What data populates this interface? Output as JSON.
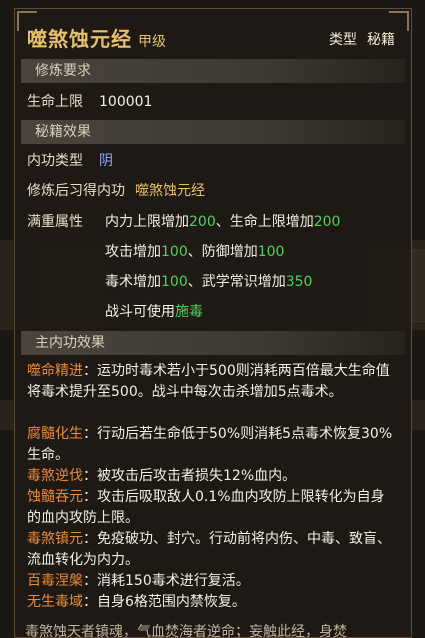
{
  "header": {
    "title": "噬煞蚀元经",
    "grade": "甲级",
    "type_label": "类型",
    "type_value": "秘籍"
  },
  "sections": {
    "requirement": "修炼要求",
    "effect": "秘籍效果",
    "main": "主内功效果"
  },
  "requirement": {
    "label": "生命上限",
    "value": "100001"
  },
  "effect": {
    "type_label": "内功类型",
    "type_value": "阴",
    "learn_label": "修炼后习得内功",
    "learn_value": "噬煞蚀元经",
    "attr_label": "满重属性",
    "attr_lines": [
      {
        "a": "内力上限增加",
        "av": "200",
        "sep": "、",
        "b": "生命上限增加",
        "bv": "200"
      },
      {
        "a": "攻击增加",
        "av": "100",
        "sep": "、",
        "b": "防御增加",
        "bv": "100"
      },
      {
        "a": "毒术增加",
        "av": "100",
        "sep": "、",
        "b": "武学常识增加",
        "bv": "350"
      }
    ],
    "battle_text": "战斗可使用",
    "battle_skill": "施毒"
  },
  "main_effects": [
    {
      "name": "噬命精进",
      "text": "：运功时毒术若小于500则消耗两百倍最大生命值将毒术提升至500。战斗中每次击杀增加5点毒术。"
    },
    {
      "name": "腐髓化生",
      "text": "：行动后若生命低于50%则消耗5点毒术恢复30%生命。"
    },
    {
      "name": "毒煞逆伐",
      "text": "：被攻击后攻击者损失12%血内。"
    },
    {
      "name": "蚀髓吞元",
      "text": "：攻击后吸取敌人0.1%血内攻防上限转化为自身的血内攻防上限。"
    },
    {
      "name": "毒煞镇元",
      "text": "：免疫破功、封穴。行动前将内伤、中毒、致盲、流血转化为内力。"
    },
    {
      "name": "百毒涅槃",
      "text": "：消耗150毒术进行复活。"
    },
    {
      "name": "无生毒域",
      "text": "：自身6格范围内禁恢复。"
    }
  ],
  "bottom_text": "毒煞蚀天者镇魂，气血焚海者逆命；妄触此经，身焚",
  "colors": {
    "gold": "#e7c06a",
    "green": "#4ed25a",
    "orange": "#e98a3a",
    "blue": "#8ea8ff"
  }
}
